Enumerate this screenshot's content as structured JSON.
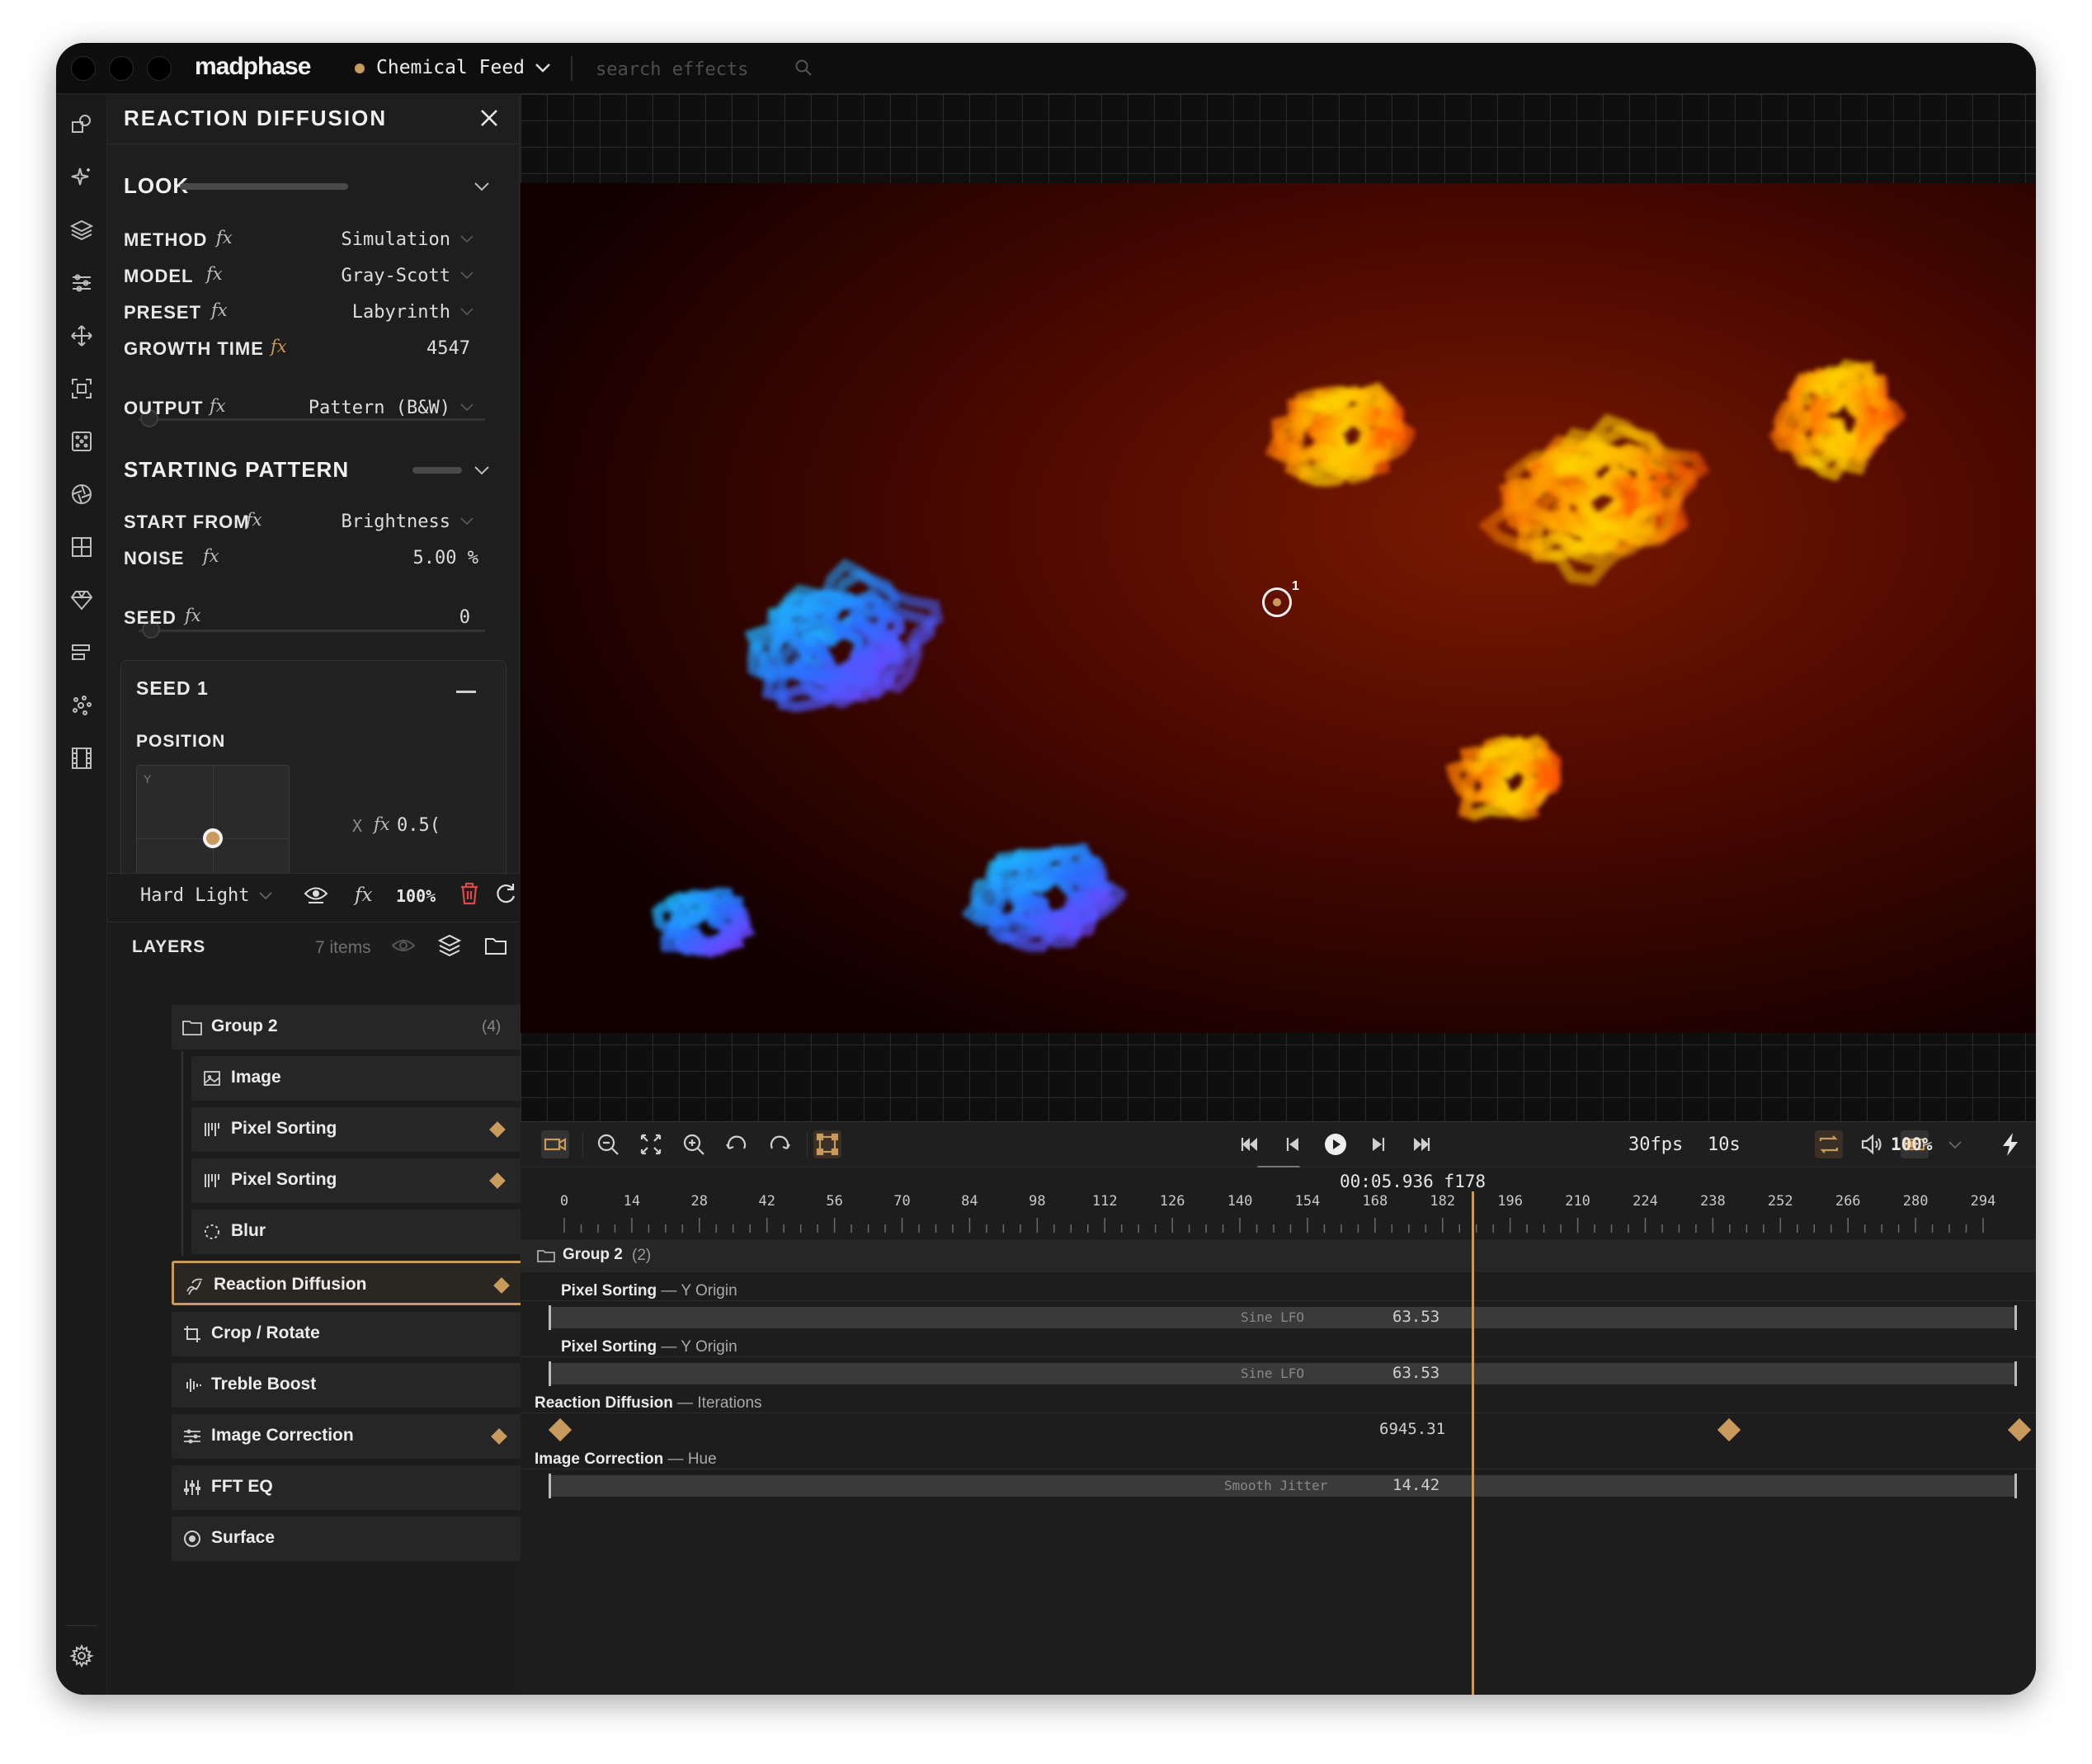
{
  "app": {
    "logo": "madphase",
    "project_name": "Chemical Feed",
    "project_dot_color": "#c89a5c",
    "search_placeholder": "search effects"
  },
  "tool_rail": {
    "tools": [
      "shapes-icon",
      "sparkle-icon",
      "layers-icon",
      "sliders-icon",
      "move-icon",
      "crop-frame-icon",
      "dice-icon",
      "aperture-icon",
      "grid-icon",
      "gem-icon",
      "align-icon",
      "particles-icon",
      "film-icon"
    ],
    "bottom": [
      "settings-icon",
      "docs-icon"
    ]
  },
  "properties": {
    "title": "REACTION DIFFUSION",
    "look": {
      "title": "LOOK",
      "method": {
        "label": "METHOD",
        "value": "Simulation"
      },
      "model": {
        "label": "MODEL",
        "value": "Gray-Scott"
      },
      "preset": {
        "label": "PRESET",
        "value": "Labyrinth"
      },
      "growth_time": {
        "label": "GROWTH TIME",
        "value": "4547"
      },
      "output": {
        "label": "OUTPUT",
        "value": "Pattern (B&W)"
      }
    },
    "starting_pattern": {
      "title": "STARTING PATTERN",
      "start_from": {
        "label": "START FROM",
        "value": "Brightness"
      },
      "noise": {
        "label": "NOISE",
        "value": "5.00 %"
      },
      "seed": {
        "label": "SEED",
        "value": "0"
      }
    },
    "seed1": {
      "title": "SEED 1",
      "position_label": "POSITION",
      "pad_axis": "Y",
      "x_label": "X",
      "x_value": "0.5("
    },
    "fx_glyph": "fx"
  },
  "blend": {
    "mode": "Hard Light",
    "fx": "fx",
    "opacity": "100%"
  },
  "layers": {
    "title": "LAYERS",
    "count": "7 items",
    "items": [
      {
        "name": "Group 2",
        "count": "(4)",
        "icon": "folder-icon",
        "keyframed": false
      },
      {
        "name": "Image",
        "icon": "image-icon",
        "keyframed": false
      },
      {
        "name": "Pixel Sorting",
        "icon": "pixel-sort-icon",
        "keyframed": true
      },
      {
        "name": "Pixel Sorting",
        "icon": "pixel-sort-icon",
        "keyframed": true
      },
      {
        "name": "Blur",
        "icon": "blur-icon",
        "keyframed": false
      },
      {
        "name": "Reaction Diffusion",
        "icon": "reaction-icon",
        "keyframed": true,
        "active": true
      },
      {
        "name": "Crop / Rotate",
        "icon": "crop-icon",
        "keyframed": false
      },
      {
        "name": "Treble Boost",
        "icon": "audio-icon",
        "keyframed": false
      },
      {
        "name": "Image Correction",
        "icon": "sliders-icon",
        "keyframed": true
      },
      {
        "name": "FFT EQ",
        "icon": "eq-icon",
        "keyframed": false
      },
      {
        "name": "Surface",
        "icon": "surface-icon",
        "keyframed": false
      }
    ]
  },
  "preview": {
    "origin_marker_label": "1"
  },
  "timeline_toolbar": {
    "fps": "30fps",
    "duration": "10s",
    "zoom": "100%"
  },
  "timeline": {
    "timecode": "00:05.936 f178",
    "ticks": [
      "0",
      "14",
      "28",
      "42",
      "56",
      "70",
      "84",
      "98",
      "112",
      "126",
      "140",
      "154",
      "168",
      "182",
      "196",
      "210",
      "224",
      "238",
      "252",
      "266",
      "280",
      "294"
    ],
    "group": {
      "name": "Group 2",
      "count": "(2)"
    },
    "tracks": [
      {
        "layer": "Pixel Sorting",
        "param": " — Y Origin",
        "modifier": "Sine LFO",
        "value": "63.53"
      },
      {
        "layer": "Pixel Sorting",
        "param": " — Y Origin",
        "modifier": "Sine LFO",
        "value": "63.53"
      },
      {
        "layer": "Reaction Diffusion",
        "param": " — Iterations",
        "modifier": "",
        "value": "6945.31"
      },
      {
        "layer": "Image Correction",
        "param": " — Hue",
        "modifier": "Smooth Jitter",
        "value": "14.42"
      }
    ]
  },
  "colors": {
    "accent": "#c89a5c",
    "background": "#1c1c1c",
    "danger": "#e04848"
  }
}
